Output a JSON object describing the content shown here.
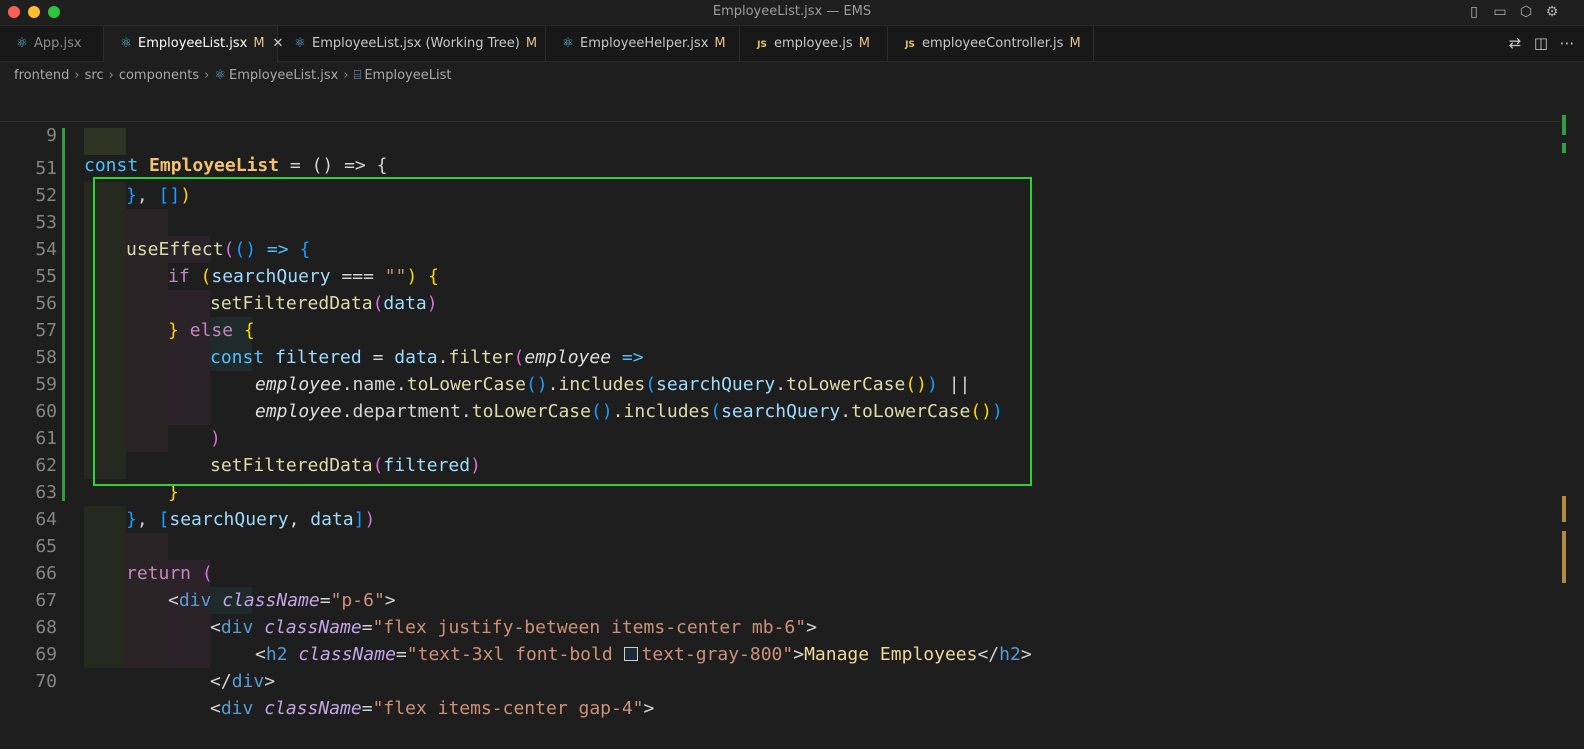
{
  "window": {
    "title": "EmployeeList.jsx — EMS"
  },
  "tabs": [
    {
      "label": "App.jsx",
      "icon": "react-icon",
      "modified": ""
    },
    {
      "label": "EmployeeList.jsx",
      "icon": "react-icon",
      "modified": "M"
    },
    {
      "label": "EmployeeList.jsx (Working Tree)",
      "icon": "react-icon",
      "modified": "M"
    },
    {
      "label": "EmployeeHelper.jsx",
      "icon": "react-icon",
      "modified": "M"
    },
    {
      "label": "employee.js",
      "icon": "js-icon",
      "icon_text": "JS",
      "modified": "M"
    },
    {
      "label": "employeeController.js",
      "icon": "js-icon",
      "icon_text": "JS",
      "modified": "M"
    }
  ],
  "breadcrumbs": [
    "frontend",
    "src",
    "components",
    "EmployeeList.jsx",
    "EmployeeList"
  ],
  "editor": {
    "sticky_line": "9",
    "line_numbers": [
      "51",
      "52",
      "53",
      "54",
      "55",
      "56",
      "57",
      "58",
      "59",
      "60",
      "61",
      "62",
      "63",
      "64",
      "65",
      "66",
      "67",
      "68",
      "69",
      "70"
    ],
    "strings": {
      "const": "const",
      "component": "EmployeeList",
      "arrow_decl": " = () => {",
      "useEffect": "useEffect",
      "if": "if",
      "else": "else",
      "return": "return",
      "searchQuery": "searchQuery",
      "data": "data",
      "filtered": "filtered",
      "employee": "employee",
      "setFilteredData": "setFilteredData",
      "filter": "filter",
      "toLowerCase": "toLowerCase",
      "includes": "includes",
      "name": "name",
      "department": "department",
      "div": "div",
      "h2": "h2",
      "className": "className",
      "class_p6": "\"p-6\"",
      "class_flex1": "\"flex justify-between items-center mb-6\"",
      "class_h2": "\"text-3xl font-bold ",
      "class_h2b": "text-gray-800\"",
      "class_flex2": "\"flex items-center gap-4\"",
      "h2_text": "Manage Employees",
      "empty_string": "\"\""
    }
  },
  "colors": {
    "highlight_box": "#2bd33a",
    "gutter_added": "#2ea043",
    "swatch": "#1f2937"
  }
}
